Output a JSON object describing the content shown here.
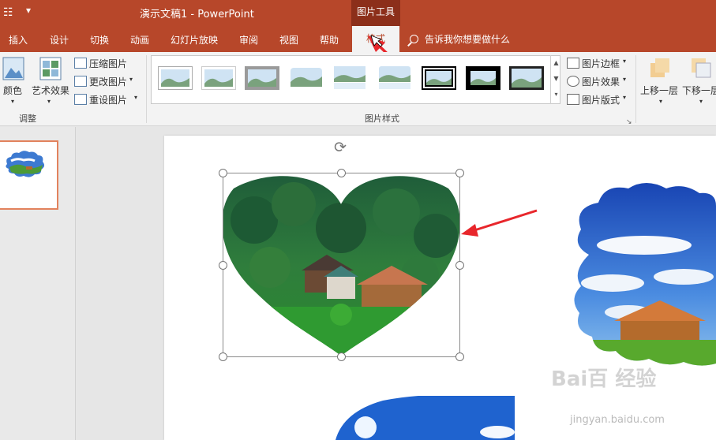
{
  "titlebar": {
    "app_title": "演示文稿1  -  PowerPoint",
    "context_tab_group": "图片工具"
  },
  "tabs": [
    {
      "label": "插入"
    },
    {
      "label": "设计"
    },
    {
      "label": "切换"
    },
    {
      "label": "动画"
    },
    {
      "label": "幻灯片放映"
    },
    {
      "label": "审阅"
    },
    {
      "label": "视图"
    },
    {
      "label": "帮助"
    },
    {
      "label": "格式"
    }
  ],
  "tell_me": "告诉我你想要做什么",
  "ribbon": {
    "adjust": {
      "color": "颜色",
      "artistic": "艺术效果",
      "compress": "压缩图片",
      "change": "更改图片",
      "reset": "重设图片",
      "group_label": "调整"
    },
    "styles": {
      "group_label": "图片样式",
      "border": "图片边框",
      "effects": "图片效果",
      "layout": "图片版式"
    },
    "arrange": {
      "bring_forward": "上移一层",
      "send_backward": "下移一层"
    }
  },
  "watermark": {
    "text": "Bai百 经验",
    "url": "jingyan.baidu.com"
  },
  "colors": {
    "accent": "#b7472a",
    "context_tab": "#8c2f1a",
    "selected_thumb_border": "#e2825d",
    "annotation_arrow": "#e8262b"
  }
}
